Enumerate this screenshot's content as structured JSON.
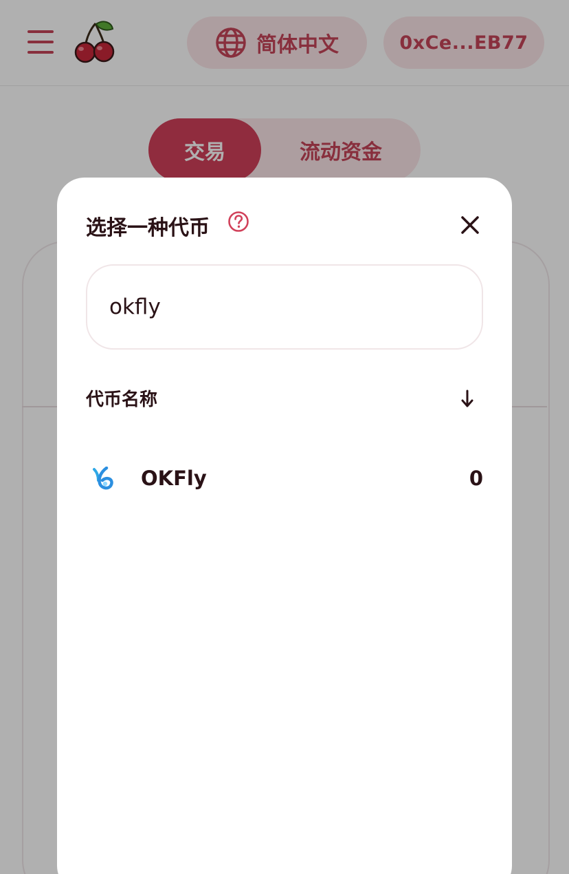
{
  "header": {
    "language_label": "简体中文",
    "wallet_address": "0xCe...EB77"
  },
  "tabs": [
    {
      "label": "交易",
      "active": true
    },
    {
      "label": "流动资金",
      "active": false
    }
  ],
  "modal": {
    "title": "选择一种代币",
    "search": {
      "value": "okfly",
      "placeholder": ""
    },
    "column_header": "代币名称",
    "sort_arrow": "↓",
    "tokens": [
      {
        "name": "OKFly",
        "balance": "0",
        "icon": "okfly-logo-icon"
      }
    ]
  },
  "colors": {
    "accent": "#d1415a",
    "accent_light": "#fbe5e8",
    "text_dark": "#2a1216"
  }
}
